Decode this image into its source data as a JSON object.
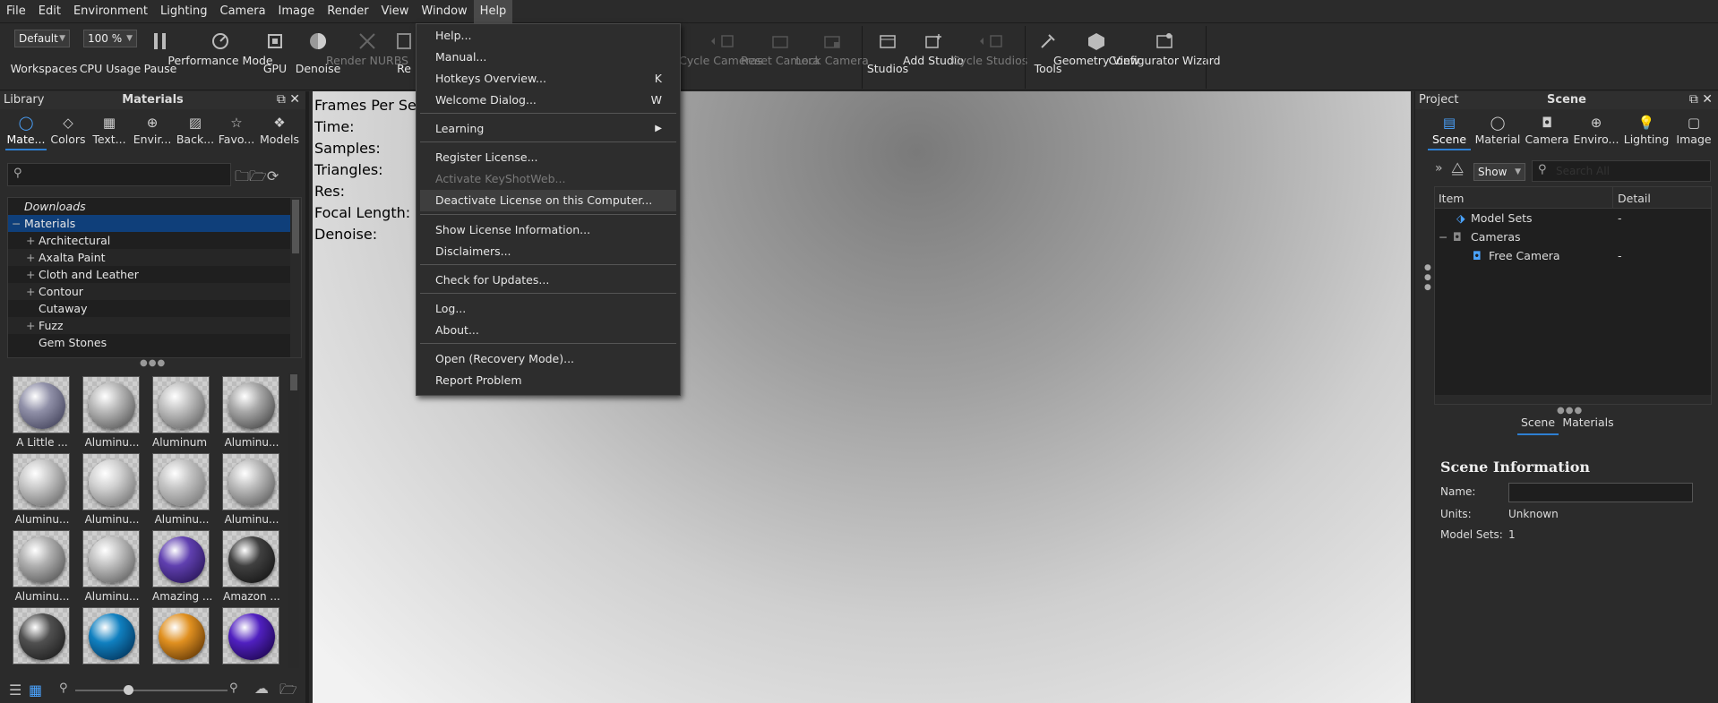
{
  "menubar": [
    "File",
    "Edit",
    "Environment",
    "Lighting",
    "Camera",
    "Image",
    "Render",
    "View",
    "Window",
    "Help"
  ],
  "toolbar": {
    "workspace_combo": "Default",
    "zoom_combo": "100 %",
    "workspaces": "Workspaces",
    "cpu_usage": "CPU Usage",
    "pause": "Pause",
    "performance_mode": "Performance Mode",
    "gpu": "GPU",
    "denoise": "Denoise",
    "render_nurbs": "Render NURBS",
    "region_partial": "Re",
    "cycle_cameras": "Cycle Cameras",
    "reset_camera": "Reset Camera",
    "lock_camera": "Lock Camera",
    "studios": "Studios",
    "add_studio": "Add Studio",
    "cycle_studios": "Cycle Studios",
    "tools": "Tools",
    "geometry_view": "Geometry View",
    "configurator_wizard": "Configurator Wizard"
  },
  "left_panel": {
    "header_left": "Library",
    "header_title": "Materials",
    "tabs": [
      "Mate...",
      "Colors",
      "Text...",
      "Envir...",
      "Back...",
      "Favo...",
      "Models"
    ],
    "tree": [
      "Downloads",
      "Materials",
      "Architectural",
      "Axalta Paint",
      "Cloth and Leather",
      "Contour",
      "Cutaway",
      "Fuzz",
      "Gem Stones"
    ],
    "thumbnails": [
      "A Little ...",
      "Aluminu...",
      "Aluminum ...",
      "Aluminu...",
      "Aluminu...",
      "Aluminu...",
      "Aluminu...",
      "Aluminu...",
      "Aluminu...",
      "Aluminu...",
      "Amazing ...",
      "Amazon ...",
      "",
      "",
      "",
      ""
    ]
  },
  "viewport": {
    "hud": [
      "Frames Per Sec",
      "Time:",
      "Samples:",
      "Triangles:",
      "Res:",
      "Focal Length:",
      "Denoise:"
    ]
  },
  "right_panel": {
    "header_left": "Project",
    "header_title": "Scene",
    "tabs": [
      "Scene",
      "Material",
      "Camera",
      "Enviro...",
      "Lighting",
      "Image"
    ],
    "show_combo": "Show",
    "search_placeholder": "Search All",
    "tree_headers": [
      "Item",
      "Detail"
    ],
    "tree_rows": [
      {
        "item": "Model Sets",
        "detail": "-"
      },
      {
        "item": "Cameras",
        "detail": ""
      },
      {
        "item": "Free Camera",
        "detail": "-"
      }
    ],
    "subtabs": [
      "Scene",
      "Materials"
    ],
    "info": {
      "title": "Scene Information",
      "name_label": "Name:",
      "units_label": "Units:",
      "units_value": "Unknown",
      "model_sets_label": "Model Sets:",
      "model_sets_value": "1"
    }
  },
  "help_menu": {
    "help": "Help...",
    "manual": "Manual...",
    "hotkeys": "Hotkeys Overview...",
    "hotkeys_key": "K",
    "welcome": "Welcome Dialog...",
    "welcome_key": "W",
    "learning": "Learning",
    "register": "Register License...",
    "activate": "Activate KeyShotWeb...",
    "deactivate": "Deactivate License on this Computer...",
    "show_license": "Show License Information...",
    "disclaimers": "Disclaimers...",
    "updates": "Check for Updates...",
    "log": "Log...",
    "about": "About...",
    "recovery": "Open (Recovery Mode)...",
    "report": "Report Problem"
  },
  "colors": {
    "accent": "#2e7fd2",
    "selection": "#0f3f7a"
  }
}
